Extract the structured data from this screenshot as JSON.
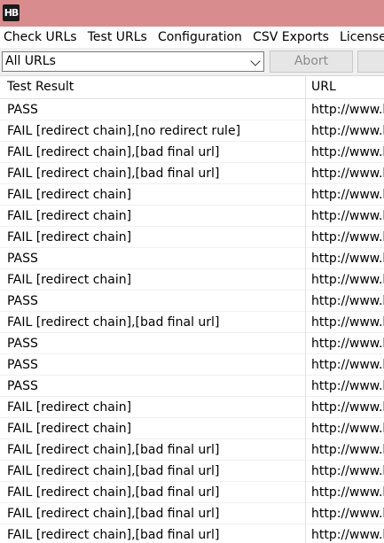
{
  "window": {
    "icon_text": "HB"
  },
  "menu": [
    "Check URLs",
    "Test URLs",
    "Configuration",
    "CSV Exports",
    "License"
  ],
  "toolbar": {
    "filter_value": "All URLs",
    "abort_label": "Abort"
  },
  "table": {
    "columns": [
      "Test Result",
      "URL"
    ],
    "rows": [
      [
        "PASS",
        "http://www.k"
      ],
      [
        "FAIL [redirect chain],[no redirect rule]",
        "http://www.k"
      ],
      [
        "FAIL [redirect chain],[bad final url]",
        "http://www.k"
      ],
      [
        "FAIL [redirect chain],[bad final url]",
        "http://www.k"
      ],
      [
        "FAIL [redirect chain]",
        "http://www.k"
      ],
      [
        "FAIL [redirect chain]",
        "http://www.k"
      ],
      [
        "FAIL [redirect chain]",
        "http://www.k"
      ],
      [
        "PASS",
        "http://www.k"
      ],
      [
        "FAIL [redirect chain]",
        "http://www.k"
      ],
      [
        "PASS",
        "http://www.k"
      ],
      [
        "FAIL [redirect chain],[bad final url]",
        "http://www.k"
      ],
      [
        "PASS",
        "http://www.k"
      ],
      [
        "PASS",
        "http://www.k"
      ],
      [
        "PASS",
        "http://www.k"
      ],
      [
        "FAIL [redirect chain]",
        "http://www.k"
      ],
      [
        "FAIL [redirect chain]",
        "http://www.k"
      ],
      [
        "FAIL [redirect chain],[bad final url]",
        "http://www.k"
      ],
      [
        "FAIL [redirect chain],[bad final url]",
        "http://www.k"
      ],
      [
        "FAIL [redirect chain],[bad final url]",
        "http://www.k"
      ],
      [
        "FAIL [redirect chain],[bad final url]",
        "http://www.k"
      ],
      [
        "FAIL [redirect chain],[bad final url]",
        "http://www.k"
      ]
    ]
  },
  "colors": {
    "titlebar": "#d98c8e",
    "toolbar": "#f0f0f0",
    "grid_line": "#e0e0e0"
  }
}
